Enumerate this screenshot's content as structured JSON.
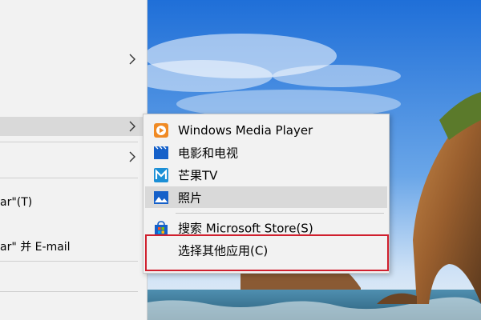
{
  "parent_menu": {
    "item_quote_t": "ar\"(T)",
    "item_quote_email": "ar\" 并 E-mail"
  },
  "submenu": {
    "items": [
      {
        "label": "Windows Media Player",
        "icon": "windows-media-player-icon"
      },
      {
        "label": "电影和电视",
        "icon": "movies-tv-icon"
      },
      {
        "label": "芒果TV",
        "icon": "mango-tv-icon"
      },
      {
        "label": "照片",
        "icon": "photos-icon"
      }
    ],
    "store_label": "搜索 Microsoft Store(S)",
    "choose_other_label": "选择其他应用(C)"
  },
  "colors": {
    "highlight": "#d9d9d9",
    "menu_bg": "#f2f2f2",
    "red_outline": "#d0202e"
  }
}
